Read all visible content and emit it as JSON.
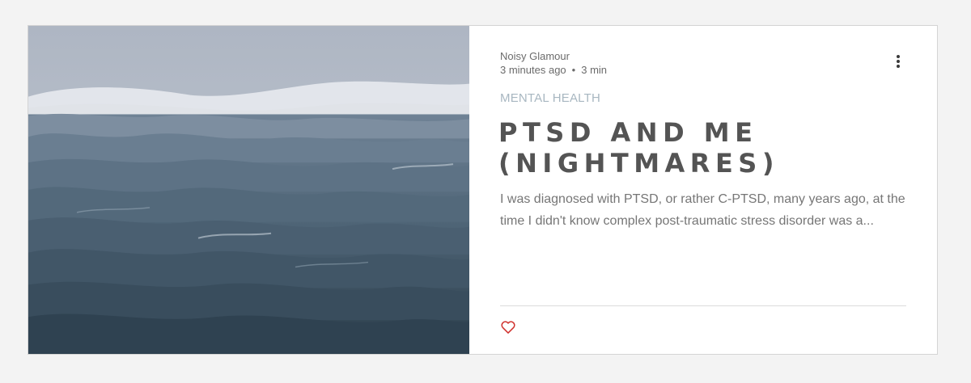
{
  "post": {
    "author": "Noisy Glamour",
    "time_ago": "3 minutes ago",
    "separator": "•",
    "read_time": "3 min",
    "category": "MENTAL HEALTH",
    "title": "PTSD AND ME (NIGHTMARES)",
    "excerpt": "I was diagnosed with PTSD, or rather C-PTSD, many years ago, at the time I didn't know complex post-traumatic stress disorder was a..."
  },
  "icons": {
    "more": "more-options-icon",
    "like": "heart-icon"
  },
  "colors": {
    "accent_like": "#d0312d",
    "category": "#a8b7c1",
    "title": "#545454",
    "sea_dark": "#2f4452",
    "mist": "#c9d0d8"
  }
}
